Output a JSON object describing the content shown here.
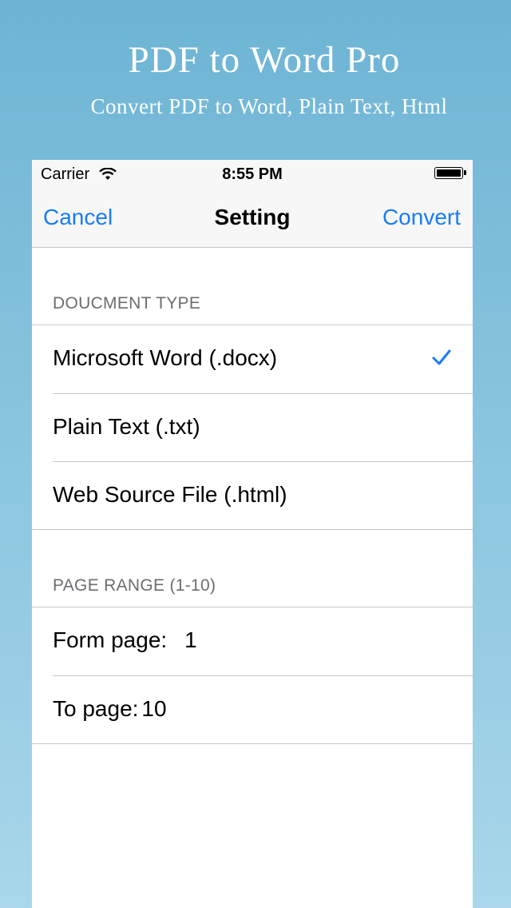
{
  "promo": {
    "title": "PDF to Word Pro",
    "subtitle": "Convert PDF to Word, Plain Text, Html"
  },
  "statusbar": {
    "carrier": "Carrier",
    "time": "8:55 PM"
  },
  "navbar": {
    "cancel_label": "Cancel",
    "title": "Setting",
    "convert_label": "Convert"
  },
  "document_type": {
    "header": "DOUCMENT TYPE",
    "options": [
      {
        "label": "Microsoft Word (.docx)",
        "selected": true
      },
      {
        "label": "Plain Text (.txt)",
        "selected": false
      },
      {
        "label": "Web Source File (.html)",
        "selected": false
      }
    ]
  },
  "page_range": {
    "header": "PAGE RANGE (1-10)",
    "from_label": "Form page:",
    "from_value": "1",
    "to_label": "To page:",
    "to_value": "10"
  },
  "colors": {
    "accent": "#1a7cf5",
    "background_top": "#6db4d4",
    "background_bottom": "#a9d6ea"
  }
}
